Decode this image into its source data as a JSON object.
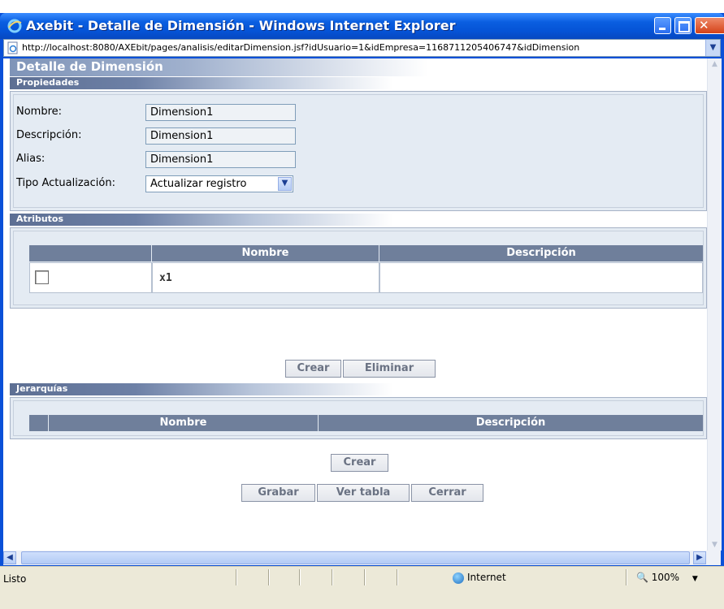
{
  "window": {
    "title": "Axebit - Detalle de Dimensión - Windows Internet Explorer",
    "url": "http://localhost:8080/AXEbit/pages/analisis/editarDimension.jsf?idUsuario=1&idEmpresa=1168711205406747&idDimension"
  },
  "page": {
    "header": "Detalle de Dimensión"
  },
  "propiedades": {
    "section_title": "Propiedades",
    "nombre_label": "Nombre:",
    "nombre_value": "Dimension1",
    "descripcion_label": "Descripción:",
    "descripcion_value": "Dimension1",
    "alias_label": "Alias:",
    "alias_value": "Dimension1",
    "tipo_label": "Tipo Actualización:",
    "tipo_value": "Actualizar registro"
  },
  "atributos": {
    "section_title": "Atributos",
    "columns": [
      "Nombre",
      "Descripción"
    ],
    "rows": [
      {
        "checked": false,
        "nombre": "x1",
        "descripcion": ""
      }
    ],
    "crear_label": "Crear",
    "eliminar_label": "Eliminar"
  },
  "jerarquias": {
    "section_title": "Jerarquías",
    "columns": [
      "Nombre",
      "Descripción"
    ],
    "crear_label": "Crear"
  },
  "footer_buttons": {
    "grabar_label": "Grabar",
    "ver_tabla_label": "Ver tabla",
    "cerrar_label": "Cerrar"
  },
  "statusbar": {
    "status_text": "Listo",
    "zone_text": "Internet",
    "zoom_text": "100%"
  }
}
